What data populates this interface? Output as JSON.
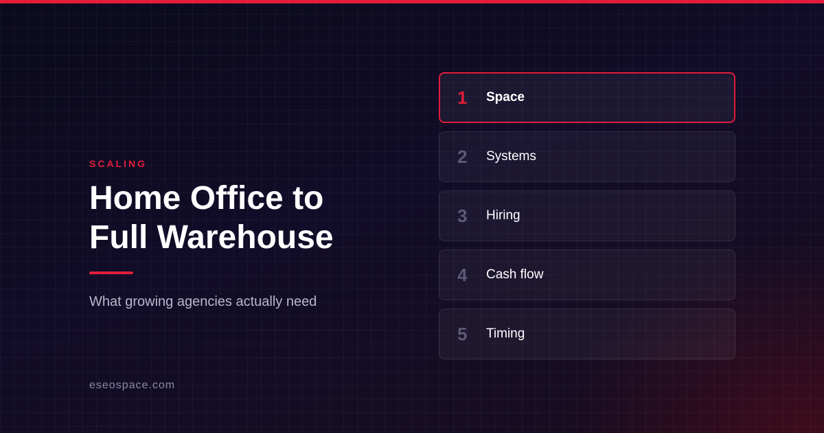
{
  "brand": {
    "accent_color": "#e11d3a",
    "background_color": "#0c0a1e"
  },
  "hero": {
    "eyebrow": "SCALING",
    "title_line_1": "Home Office to",
    "title_line_2": "Full Warehouse",
    "subtitle": "What growing agencies actually need",
    "site": "eseospace.com"
  },
  "steps": [
    {
      "number": "1",
      "label": "Space",
      "active": true
    },
    {
      "number": "2",
      "label": "Systems",
      "active": false
    },
    {
      "number": "3",
      "label": "Hiring",
      "active": false
    },
    {
      "number": "4",
      "label": "Cash flow",
      "active": false
    },
    {
      "number": "5",
      "label": "Timing",
      "active": false
    }
  ]
}
